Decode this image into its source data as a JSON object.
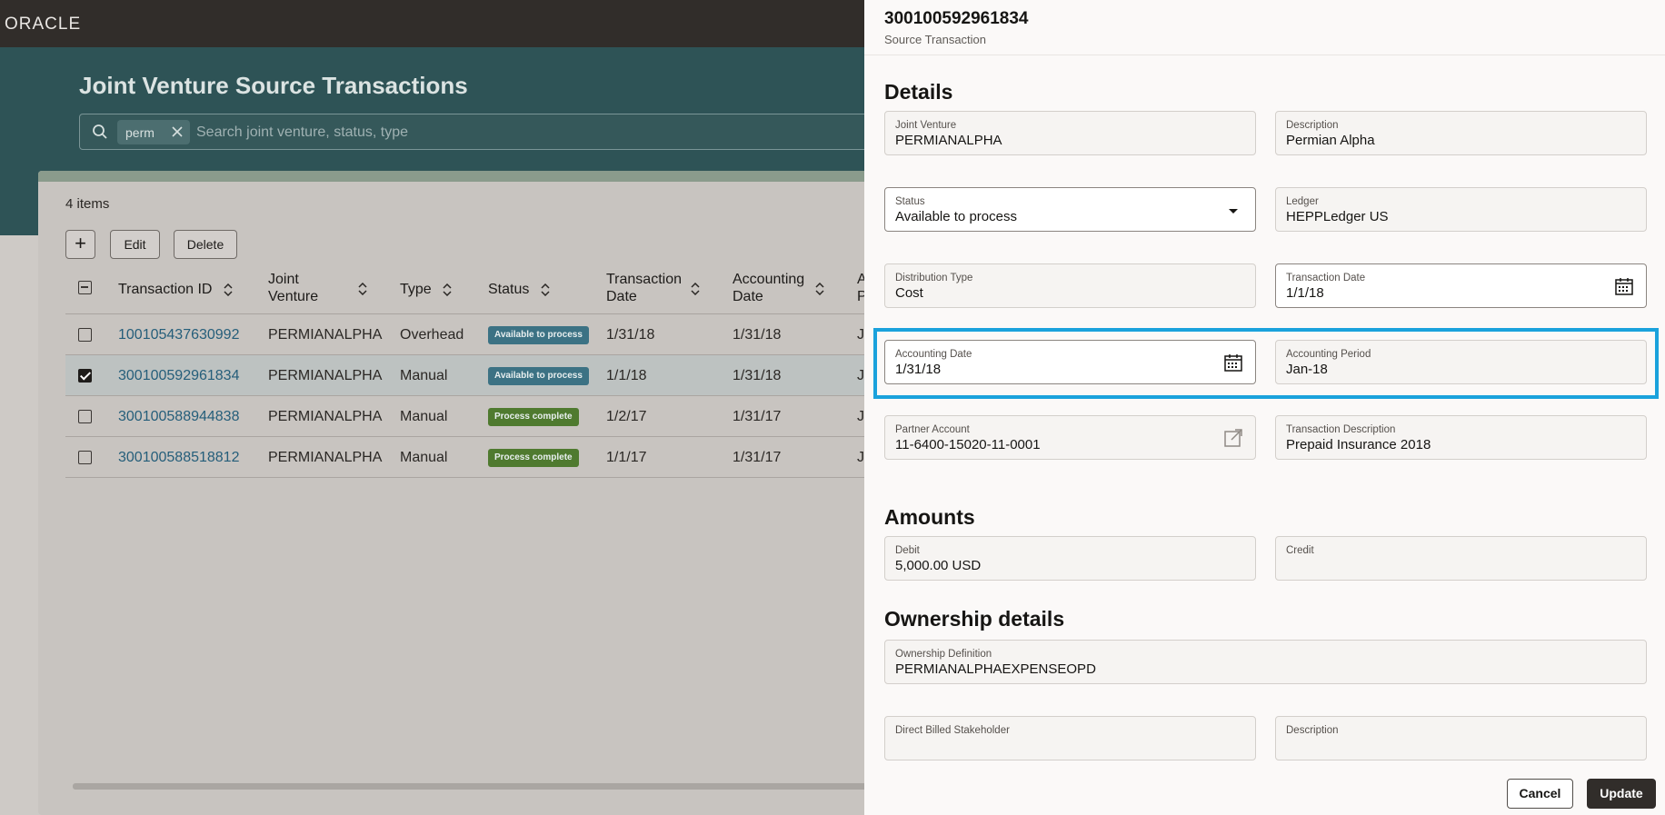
{
  "app": {
    "logo": "ORACLE"
  },
  "page": {
    "title": "Joint Venture Source Transactions",
    "search": {
      "chip": "perm",
      "placeholder": "Search joint venture, status, type"
    },
    "items_count": "4 items",
    "toolbar": {
      "add_label": "+",
      "edit_label": "Edit",
      "delete_label": "Delete"
    },
    "table": {
      "columns": [
        {
          "label": "Transaction ID"
        },
        {
          "label": "Joint Venture"
        },
        {
          "label": "Type"
        },
        {
          "label": "Status"
        },
        {
          "label": "Transaction Date"
        },
        {
          "label": "Accounting Date"
        },
        {
          "label": "A P"
        }
      ],
      "rows": [
        {
          "id": "100105437630992",
          "jv": "PERMIANALPHA",
          "type": "Overhead",
          "status": "Available to process",
          "status_kind": "available",
          "tdate": "1/31/18",
          "adate": "1/31/18",
          "extra": "J",
          "checked": false
        },
        {
          "id": "300100592961834",
          "jv": "PERMIANALPHA",
          "type": "Manual",
          "status": "Available to process",
          "status_kind": "available",
          "tdate": "1/1/18",
          "adate": "1/31/18",
          "extra": "J",
          "checked": true
        },
        {
          "id": "300100588944838",
          "jv": "PERMIANALPHA",
          "type": "Manual",
          "status": "Process complete",
          "status_kind": "complete",
          "tdate": "1/2/17",
          "adate": "1/31/17",
          "extra": "J",
          "checked": false
        },
        {
          "id": "300100588518812",
          "jv": "PERMIANALPHA",
          "type": "Manual",
          "status": "Process complete",
          "status_kind": "complete",
          "tdate": "1/1/17",
          "adate": "1/31/17",
          "extra": "J",
          "checked": false
        }
      ]
    }
  },
  "drawer": {
    "title": "300100592961834",
    "subtitle": "Source Transaction",
    "sections": {
      "details": "Details",
      "amounts": "Amounts",
      "ownership": "Ownership details"
    },
    "fields": {
      "joint_venture": {
        "label": "Joint Venture",
        "value": "PERMIANALPHA"
      },
      "description": {
        "label": "Description",
        "value": "Permian Alpha"
      },
      "status": {
        "label": "Status",
        "value": "Available to process"
      },
      "ledger": {
        "label": "Ledger",
        "value": "HEPPLedger US"
      },
      "distribution_type": {
        "label": "Distribution Type",
        "value": "Cost"
      },
      "transaction_date": {
        "label": "Transaction Date",
        "value": "1/1/18"
      },
      "accounting_date": {
        "label": "Accounting Date",
        "value": "1/31/18"
      },
      "accounting_period": {
        "label": "Accounting Period",
        "value": "Jan-18"
      },
      "partner_account": {
        "label": "Partner Account",
        "value": "11-6400-15020-11-0001"
      },
      "transaction_description": {
        "label": "Transaction Description",
        "value": "Prepaid Insurance 2018"
      },
      "debit": {
        "label": "Debit",
        "value": "5,000.00 USD"
      },
      "credit": {
        "label": "Credit",
        "value": ""
      },
      "ownership_definition": {
        "label": "Ownership Definition",
        "value": "PERMIANALPHAEXPENSEOPD"
      },
      "direct_billed_stakeholder": {
        "label": "Direct Billed Stakeholder",
        "value": ""
      },
      "ownership_description": {
        "label": "Description",
        "value": ""
      }
    },
    "buttons": {
      "cancel": "Cancel",
      "update": "Update"
    }
  },
  "colors": {
    "highlight": "#1aa2dc",
    "available_badge": "#3c7284",
    "complete_badge": "#4f7a2f",
    "link": "#255e7a"
  }
}
